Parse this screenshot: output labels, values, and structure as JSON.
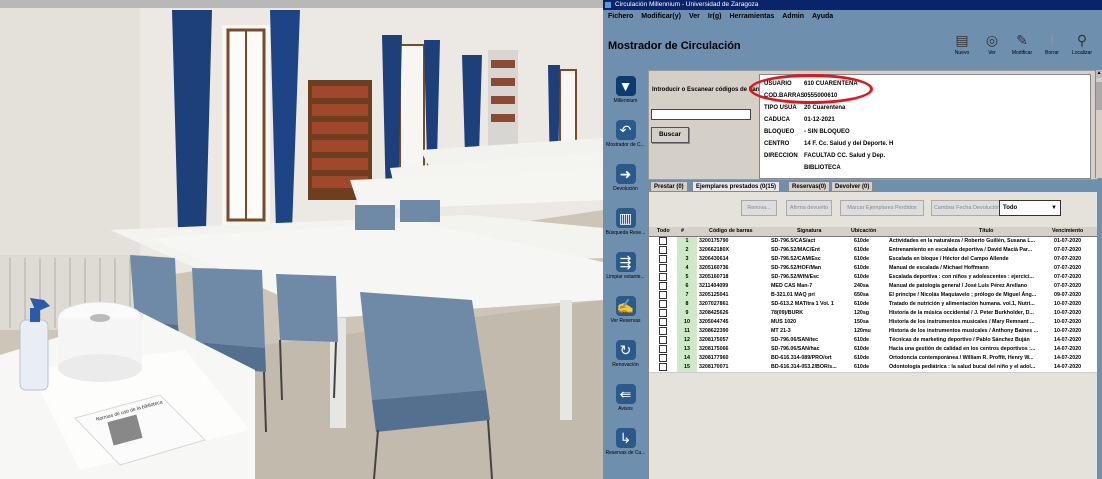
{
  "app": {
    "window_title": "Circulación Millennium - Universidad de Zaragoza",
    "menu": [
      "Fichero",
      "Modificar(y)",
      "Ver",
      "Ir(g)",
      "Herramientas",
      "Admin",
      "Ayuda"
    ],
    "header": "Mostrador de Circulación",
    "toolbar": [
      {
        "label": "Nuevo",
        "icon": "new-doc-icon"
      },
      {
        "label": "Ver",
        "icon": "view-icon"
      },
      {
        "label": "Modificar",
        "icon": "edit-icon"
      },
      {
        "label": "Borrar",
        "icon": "delete-icon"
      },
      {
        "label": "Localizar",
        "icon": "search-icon"
      }
    ],
    "nav": [
      {
        "label": "Millennium",
        "icon": "millennium-icon"
      },
      {
        "label": "Mostrador de C...",
        "icon": "checkout-icon"
      },
      {
        "label": "Devolución",
        "icon": "return-icon"
      },
      {
        "label": "Búsqueda Rese...",
        "icon": "hold-search-icon"
      },
      {
        "label": "Limpiar estante...",
        "icon": "shelf-clear-icon"
      },
      {
        "label": "Ver Reservas",
        "icon": "holds-view-icon"
      },
      {
        "label": "Renovación",
        "icon": "renew-icon"
      },
      {
        "label": "Avisos",
        "icon": "notices-icon"
      },
      {
        "label": "Reservas de Cu...",
        "icon": "course-reserves-icon"
      }
    ],
    "scan_label": "Introducir o Escanear códigos de barras",
    "scan_value": "",
    "search_button": "Buscar",
    "patron": [
      {
        "key": "USUARIO",
        "value": "610 CUARENTENA"
      },
      {
        "key": "COD.BARRAS",
        "value": "0555000610"
      },
      {
        "key": "TIPO USUA",
        "value": "20 Cuarentena"
      },
      {
        "key": "CADUCA",
        "value": "01-12-2021"
      },
      {
        "key": "BLOQUEO",
        "value": "- SIN BLOQUEO"
      },
      {
        "key": "CENTRO",
        "value": "14 F. Cc. Salud y del Deporte. H"
      },
      {
        "key": "DIRECCION",
        "value": "FACULTAD CC. Salud y Dep."
      },
      {
        "key": "",
        "value": "BIBLIOTECA"
      }
    ],
    "tabs": [
      "Prestar (0)",
      "Ejemplares prestados (0(15)",
      "Reservas(0)",
      "Devolver (0)"
    ],
    "active_tab": 1,
    "actions": [
      "Renova...",
      "Afirma devuelto",
      "Marcar Ejemplares Perdidos",
      "Cambiar Fecha Devolución"
    ],
    "select_value": "Todo",
    "columns": [
      "Todo",
      "#",
      "Código de barras",
      "Signatura",
      "Ubicación",
      "Título",
      "Vencimiento"
    ],
    "rows": [
      [
        "1",
        "3200175790",
        "SD-796.5/CAS/act",
        "610de",
        "Actividades en la naturaleza / Roberto Guillén, Susana L...",
        "01-07-2020"
      ],
      [
        "2",
        "320662180X",
        "SD-796.52/MAC/Ent",
        "610de",
        "Entrenamiento en escalada deportiva / David Macià Par...",
        "07-07-2020"
      ],
      [
        "3",
        "3206430614",
        "SD-796.52/CAM/Esc",
        "610de",
        "Escalada en bloque / Héctor del Campo Allende",
        "07-07-2020"
      ],
      [
        "4",
        "3205160736",
        "SD-796.52/HOF/Man",
        "610de",
        "Manual de escalada / Michael Hoffmann",
        "07-07-2020"
      ],
      [
        "5",
        "3205160718",
        "SD-796.52/WIN/Esc",
        "610de",
        "Escalada deportiva : con niños y adolescentes : ejercici...",
        "07-07-2020"
      ],
      [
        "6",
        "3211404099",
        "MED CAS Man-7",
        "240sa",
        "Manual de patología general / José Luis Pérez Arellano",
        "07-07-2020"
      ],
      [
        "7",
        "3205125041",
        "B-321.01 MAQ pri",
        "650sa",
        "El príncipe / Nicolás Maquiavelo ; prólogo de Miguel Áng...",
        "09-07-2020"
      ],
      [
        "8",
        "3207027861",
        "SD-613.2 MAT/tra 1 Vol. 1",
        "610de",
        "Tratado de nutrición y alimentación humana. vol.1, Nutri...",
        "10-07-2020"
      ],
      [
        "9",
        "3208425626",
        "78(09)/BURK",
        "120sg",
        "Historia de la música occidental / J. Peter Burkholder, D...",
        "10-07-2020"
      ],
      [
        "10",
        "3205044745",
        "MUS 1020",
        "150sa",
        "Historia de los instrumentos musicales / Mary Remnant ...",
        "10-07-2020"
      ],
      [
        "11",
        "3208622390",
        "MT 21-3",
        "120mu",
        "Historia de los instrumentos musicales / Anthony Baines ...",
        "10-07-2020"
      ],
      [
        "12",
        "3208175057",
        "SD-796.06/SAN/tec",
        "610de",
        "Técnicas de marketing deportivo / Pablo Sánchez Buján",
        "14-07-2020"
      ],
      [
        "13",
        "3208175066",
        "SD-796.06/SAN/hac",
        "610de",
        "Hacia una gestión de calidad en los centros deportivos :...",
        "14-07-2020"
      ],
      [
        "14",
        "3208177960",
        "BD-616.314-089/PRO/ort",
        "610de",
        "Ortodoncia contemporánea / William R. Proffit, Henry W...",
        "14-07-2020"
      ],
      [
        "15",
        "3208170071",
        "BD-616.314-053.2/BOR/s...",
        "610de",
        "Odontología pediátrica : la salud bucal del niño y el adol...",
        "14-07-2020"
      ]
    ]
  },
  "photo": {
    "card_text": "Normas de uso de la biblioteca",
    "colors": {
      "curtain": "#1d3f7a",
      "wall": "#ece9e4",
      "table": "#f2f2ef",
      "chair": "#6f8aa6",
      "floor": "#c9c3b6"
    }
  }
}
